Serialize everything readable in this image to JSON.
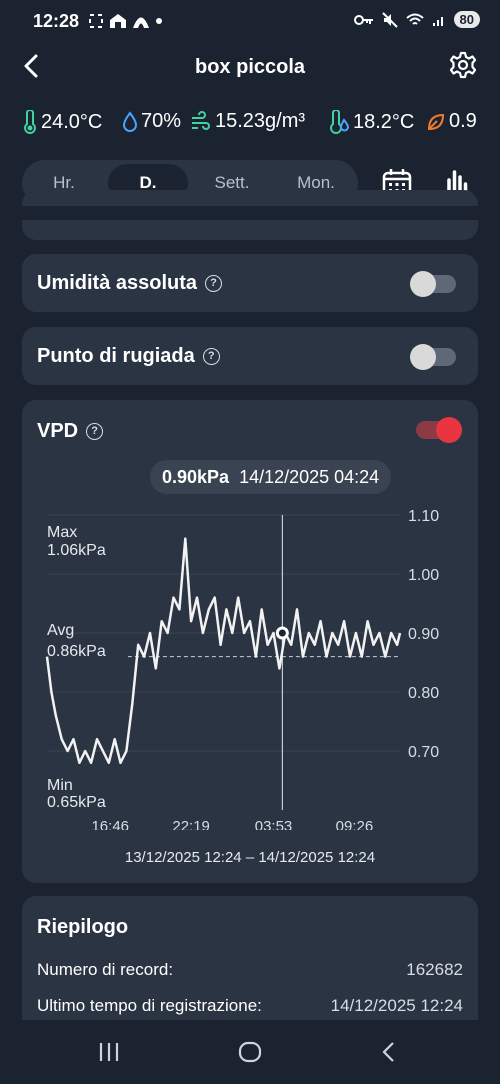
{
  "status_bar": {
    "time": "12:28",
    "battery": "80"
  },
  "app_bar": {
    "title": "box piccola"
  },
  "metrics": {
    "temperature": "24.0°C",
    "humidity": "70%",
    "absolute_humidity": "15.23g/m³",
    "dew_point": "18.2°C",
    "vpd": "0.9"
  },
  "range_tabs": {
    "hr": "Hr.",
    "day": "D.",
    "week": "Sett.",
    "month": "Mon.",
    "selected": "D."
  },
  "cards": {
    "absolute_humidity": {
      "label": "Umidità assoluta",
      "enabled": false
    },
    "dew_point": {
      "label": "Punto di rugiada",
      "enabled": false
    },
    "vpd": {
      "label": "VPD",
      "enabled": true,
      "tooltip_value": "0.90kPa",
      "tooltip_time": "14/12/2025 04:24",
      "max_label": "Max",
      "max_value": "1.06kPa",
      "avg_label": "Avg",
      "avg_value": "0.86kPa",
      "min_label": "Min",
      "min_value": "0.65kPa",
      "range_text": "13/12/2025 12:24 – 14/12/2025 12:24"
    }
  },
  "summary": {
    "title": "Riepilogo",
    "rows": [
      {
        "label": "Numero di record:",
        "value": "162682"
      },
      {
        "label": "Ultimo tempo di registrazione:",
        "value": "14/12/2025 12:24"
      }
    ]
  },
  "colors": {
    "background": "#1b2330",
    "card": "#2b3443",
    "accent_red": "#e8353f",
    "temp_green": "#3ed3a0",
    "humidity_blue": "#4aa3ff",
    "leaf_orange": "#f07b2e"
  },
  "chart_data": {
    "type": "line",
    "title": "",
    "xlabel": "",
    "ylabel": "",
    "y_unit": "kPa",
    "ylim": [
      0.6,
      1.1
    ],
    "y_ticks": [
      0.7,
      0.8,
      0.9,
      1.0,
      1.1
    ],
    "y_tick_labels": [
      "0.70",
      "0.80",
      "0.90",
      "1.00",
      "1.10"
    ],
    "x_ticks": [
      "16:46",
      "22:19",
      "03:53",
      "09:26"
    ],
    "x_start": "13/12/2025 12:24",
    "x_end": "14/12/2025 12:24",
    "grid": true,
    "avg_line": 0.86,
    "cursor_time": "14/12/2025 04:24",
    "cursor_value": 0.9,
    "series": [
      {
        "name": "",
        "x_hours": [
          0.0,
          0.3,
          0.6,
          1.0,
          1.4,
          1.8,
          2.2,
          2.6,
          3.0,
          3.4,
          3.8,
          4.2,
          4.6,
          5.0,
          5.4,
          5.8,
          6.2,
          6.6,
          7.0,
          7.4,
          7.8,
          8.2,
          8.6,
          9.0,
          9.4,
          9.8,
          10.2,
          10.6,
          11.0,
          11.4,
          11.8,
          12.2,
          12.6,
          13.0,
          13.4,
          13.8,
          14.2,
          14.6,
          15.0,
          15.4,
          15.8,
          16.2,
          16.6,
          17.0,
          17.4,
          17.8,
          18.2,
          18.6,
          19.0,
          19.4,
          19.8,
          20.2,
          20.6,
          21.0,
          21.4,
          21.8,
          22.2,
          22.6,
          23.0,
          23.4,
          23.8,
          24.0
        ],
        "values": [
          0.86,
          0.8,
          0.76,
          0.72,
          0.7,
          0.72,
          0.68,
          0.7,
          0.68,
          0.72,
          0.7,
          0.68,
          0.72,
          0.68,
          0.7,
          0.78,
          0.88,
          0.86,
          0.9,
          0.84,
          0.92,
          0.9,
          0.96,
          0.94,
          1.06,
          0.92,
          0.96,
          0.9,
          0.94,
          0.96,
          0.88,
          0.94,
          0.9,
          0.96,
          0.9,
          0.92,
          0.86,
          0.94,
          0.88,
          0.9,
          0.84,
          0.9,
          0.88,
          0.94,
          0.86,
          0.9,
          0.88,
          0.92,
          0.86,
          0.9,
          0.88,
          0.92,
          0.86,
          0.9,
          0.86,
          0.92,
          0.88,
          0.9,
          0.86,
          0.9,
          0.88,
          0.9
        ]
      }
    ]
  }
}
